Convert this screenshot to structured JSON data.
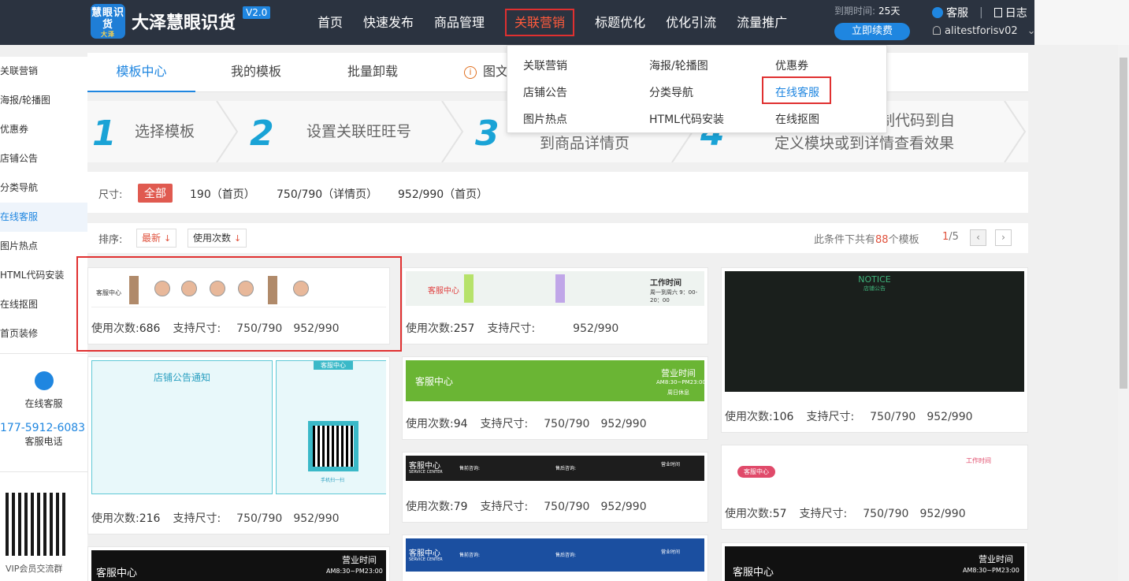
{
  "header": {
    "logo_text": "慧眼识货",
    "logo_sub": "大泽",
    "title": "大泽慧眼识货",
    "version": "V2.0",
    "nav": [
      "首页",
      "快速发布",
      "商品管理",
      "关联营销",
      "标题优化",
      "优化引流",
      "流量推广"
    ],
    "expire_label": "到期时间:",
    "expire_value": "25天",
    "renew": "立即续费",
    "service": "客服",
    "log": "日志",
    "username": "alitestforisv02",
    "chevron": "⌄"
  },
  "dropdown": {
    "col1": [
      "关联营销",
      "店铺公告",
      "图片热点"
    ],
    "col2": [
      "海报/轮播图",
      "分类导航",
      "HTML代码安装"
    ],
    "col3": [
      "优惠券",
      "在线客服",
      "在线抠图"
    ]
  },
  "sidebar": {
    "items": [
      "关联营销",
      "海报/轮播图",
      "优惠券",
      "店铺公告",
      "分类导航",
      "在线客服",
      "图片热点",
      "HTML代码安装",
      "在线抠图",
      "首页装修"
    ],
    "cs_label": "在线客服",
    "phone": "177-5912-6083",
    "phone_label": "客服电话",
    "qr_label": "VIP会员交流群"
  },
  "tabs": [
    "模板中心",
    "我的模板",
    "批量卸载",
    "图文"
  ],
  "steps": {
    "s1_num": "1",
    "s1": "选择模板",
    "s2_num": "2",
    "s2": "设置关联旺旺号",
    "s3_num": "3",
    "s3": "到商品详情页",
    "s4_num": "4",
    "s4a": "制代码到自",
    "s4b": "定义模块或到详情查看效果"
  },
  "filter": {
    "label": "尺寸:",
    "all": "全部",
    "opts": [
      "190（首页）",
      "750/790（详情页）",
      "952/990（首页）"
    ]
  },
  "sort": {
    "label": "排序:",
    "newest": "最新",
    "usage": "使用次数",
    "arrow": "↓",
    "count_pre": "此条件下共有",
    "count": "88",
    "count_post": "个模板",
    "page_cur": "1",
    "page_total": "/5",
    "prev": "‹",
    "next": "›"
  },
  "meta": {
    "usage": "使用次数:",
    "support": "支持尺寸:"
  },
  "cards": [
    {
      "uses": "686",
      "s1": "750/790",
      "s2": "952/990"
    },
    {
      "uses": "257",
      "s1": "",
      "s2": "952/990"
    },
    {
      "uses": "106",
      "s1": "750/790",
      "s2": "952/990"
    },
    {
      "uses": "216",
      "s1": "750/790",
      "s2": "952/990"
    },
    {
      "uses": "94",
      "s1": "750/790",
      "s2": "952/990"
    },
    {
      "uses": "57",
      "s1": "750/790",
      "s2": "952/990"
    },
    {
      "uses": "79",
      "s1": "750/790",
      "s2": "952/990"
    }
  ],
  "thumbs": {
    "c1_cs": "客服中心",
    "c2_cs": "客服中心",
    "c2_time": "工作时间",
    "c2_time_sub": "周一到周六 9：00-20：00",
    "c3_notice": "NOTICE",
    "c3_sub": "店铺公告",
    "c4_title": "店铺公告通知",
    "c4_cs": "客服中心",
    "c4_scan": "手机扫一扫",
    "c5_cs": "客服中心",
    "c5_time": "营业时间",
    "c5_hours": "AM8:30~PM23:00",
    "c5_rest": "周日休息",
    "c6_cs": "客服中心",
    "c6_time": "工作时间",
    "c7_cs": "客服中心",
    "c7_en": "SERVICE CENTER",
    "c7_pre": "售前咨询:",
    "c7_post": "售后咨询:",
    "c7_time": "营业时间",
    "c8_cs": "客服中心",
    "c8_time": "营业时间",
    "c8_hours": "AM8:30~PM23:00",
    "c9_cs": "客服中心",
    "c9_en": "SERVICE CENTER",
    "c9_pre": "售前咨询:",
    "c9_post": "售后咨询:",
    "c9_time": "营业时间",
    "c10_cs": "客服中心",
    "c10_time": "营业时间",
    "c10_hours": "AM8:30~PM23:00"
  }
}
